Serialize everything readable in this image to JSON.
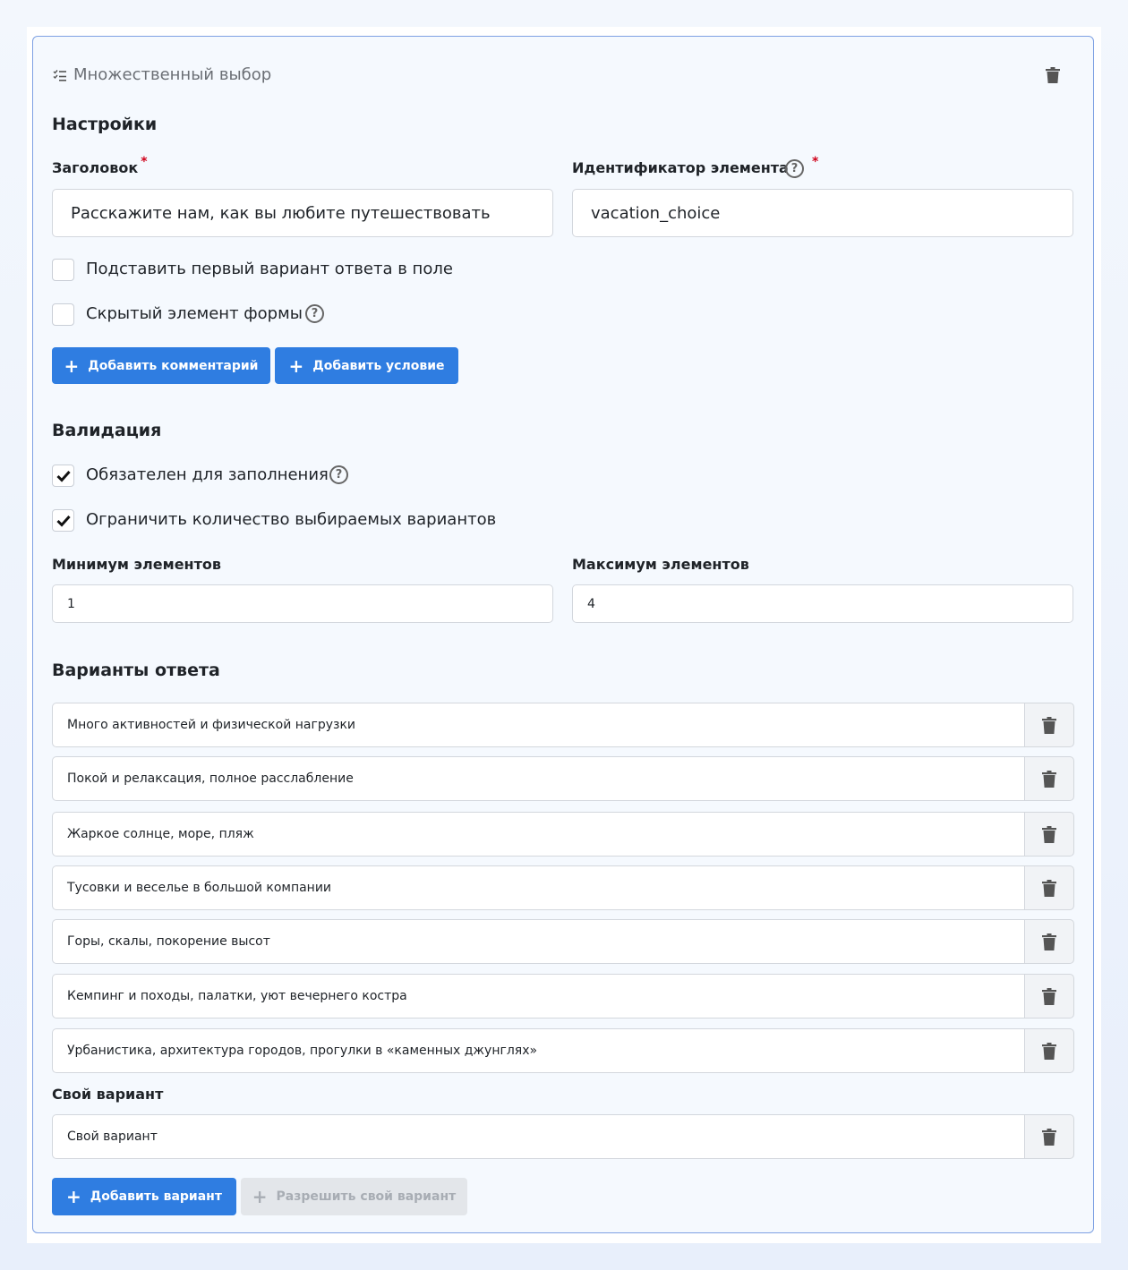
{
  "card": {
    "title": "Множественный выбор"
  },
  "settings": {
    "section_title": "Настройки",
    "title_label": "Заголовок",
    "title_value": "Расскажите нам, как вы любите путешествовать",
    "id_label": "Идентификатор элемента",
    "id_value": "vacation_choice",
    "required_mark": "*",
    "help_glyph": "?",
    "checkbox_prefill": "Подставить первый вариант ответа в поле",
    "checkbox_hidden": "Скрытый элемент формы",
    "add_comment": "Добавить комментарий",
    "add_condition": "Добавить условие",
    "plus": "+"
  },
  "validation": {
    "section_title": "Валидация",
    "required_label": "Обязателен для заполнения",
    "required_checked": true,
    "limit_label": "Ограничить количество выбираемых вариантов",
    "limit_checked": true,
    "min_label": "Минимум элементов",
    "min_value": "1",
    "max_label": "Максимум элементов",
    "max_value": "4"
  },
  "answers": {
    "section_title": "Варианты ответа",
    "options": [
      "Много активностей и физической нагрузки",
      "Покой и релаксация, полное расслабление",
      "Жаркое солнце, море, пляж",
      "Тусовки и веселье в большой компании",
      "Горы, скалы, покорение высот",
      "Кемпинг и походы,  палатки, уют вечернего костра",
      "Урбанистика, архитектура городов, прогулки в «каменных джунглях»"
    ],
    "custom_title": "Свой вариант",
    "custom_value": "Свой вариант",
    "add_option": "Добавить вариант",
    "allow_custom": "Разрешить свой вариант"
  },
  "icons": {
    "header_icon": "checklist-icon",
    "delete_icon": "trash-icon",
    "check_icon": "checkmark-icon"
  },
  "colors": {
    "primary": "#2f7de1",
    "border_accent": "#7ea1e3",
    "required": "#d0021b"
  }
}
